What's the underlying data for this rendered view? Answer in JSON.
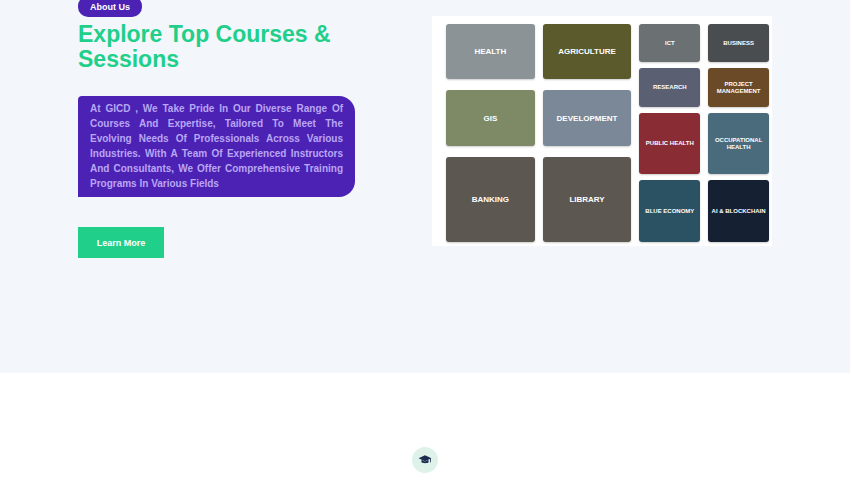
{
  "about": {
    "badge": "About Us",
    "heading": "Explore Top Courses & Sessions",
    "description": "At GICD , We Take Pride In Our Diverse Range Of Courses And Expertise, Tailored To Meet The Evolving Needs Of Professionals Across Various Industries. With A Team Of Experienced Instructors And Consultants, We Offer Comprehensive Training Programs In Various Fields",
    "button": "Learn More"
  },
  "course_grid": {
    "columns": [
      {
        "size": "large",
        "tiles": [
          {
            "label": "HEALTH",
            "color": "#8b9396"
          },
          {
            "label": "GIS",
            "color": "#7e8a66"
          },
          {
            "label": "BANKING",
            "color": "#5c5751"
          }
        ]
      },
      {
        "size": "large",
        "tiles": [
          {
            "label": "AGRICULTURE",
            "color": "#5a5a2c"
          },
          {
            "label": "DEVELOPMENT",
            "color": "#7a8898"
          },
          {
            "label": "LIBRARY",
            "color": "#5c5751"
          }
        ]
      },
      {
        "size": "small",
        "tiles": [
          {
            "label": "ICT",
            "color": "#6b7073"
          },
          {
            "label": "RESEARCH",
            "color": "#5a6072"
          },
          {
            "label": "PUBLIC HEALTH",
            "color": "#8a2c33"
          },
          {
            "label": "BLUE ECONOMY",
            "color": "#2b5262"
          }
        ]
      },
      {
        "size": "small",
        "tiles": [
          {
            "label": "BUSINESS",
            "color": "#4a4d50"
          },
          {
            "label": "PROJECT MANAGEMENT",
            "color": "#6b4a28"
          },
          {
            "label": "OCCUPATIONAL HEALTH",
            "color": "#4a6b7b"
          },
          {
            "label": "AI & BLOCKCHAIN",
            "color": "#152033"
          }
        ]
      }
    ]
  }
}
